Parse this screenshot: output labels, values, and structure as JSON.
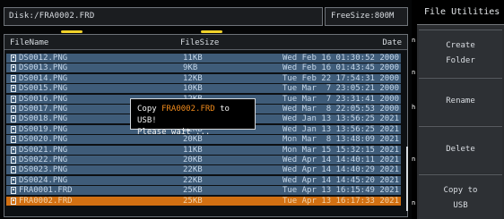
{
  "path_bar": {
    "text": "Disk:/FRA0002.FRD"
  },
  "free_size": {
    "text": "FreeSize:800M"
  },
  "columns": {
    "name": "FileName",
    "size": "FileSize",
    "date": "Date"
  },
  "rows": [
    {
      "name": "DS0012.PNG",
      "size": "11KB",
      "date": "Wed Feb 16 01:30:52 2000"
    },
    {
      "name": "DS0013.PNG",
      "size": "9KB",
      "date": "Wed Feb 16 01:43:45 2000"
    },
    {
      "name": "DS0014.PNG",
      "size": "12KB",
      "date": "Tue Feb 22 17:54:31 2000"
    },
    {
      "name": "DS0015.PNG",
      "size": "10KB",
      "date": "Tue Mar  7 23:05:21 2000"
    },
    {
      "name": "DS0016.PNG",
      "size": "12KB",
      "date": "Tue Mar  7 23:31:41 2000"
    },
    {
      "name": "DS0017.PNG",
      "size": "12KB",
      "date": "Wed Mar  8 22:05:53 2000"
    },
    {
      "name": "DS0018.PNG",
      "size": "22KB",
      "date": "Wed Jan 13 13:56:25 2021"
    },
    {
      "name": "DS0019.PNG",
      "size": "22KB",
      "date": "Wed Jan 13 13:56:25 2021"
    },
    {
      "name": "DS0020.PNG",
      "size": "20KB",
      "date": "Mon Mar  8 13:48:09 2021"
    },
    {
      "name": "DS0021.PNG",
      "size": "11KB",
      "date": "Mon Mar 15 15:32:15 2021"
    },
    {
      "name": "DS0022.PNG",
      "size": "20KB",
      "date": "Wed Apr 14 14:40:11 2021"
    },
    {
      "name": "DS0023.PNG",
      "size": "22KB",
      "date": "Wed Apr 14 14:40:29 2021"
    },
    {
      "name": "DS0024.PNG",
      "size": "22KB",
      "date": "Wed Apr 14 14:45:20 2021"
    },
    {
      "name": "FRA0001.FRD",
      "size": "25KB",
      "date": "Tue Apr 13 16:15:49 2021"
    },
    {
      "name": "FRA0002.FRD",
      "size": "25KB",
      "date": "Tue Apr 13 16:17:33 2021",
      "selected": true
    }
  ],
  "dialog": {
    "prefix": "Copy ",
    "filename": "FRA0002.FRD",
    "suffix": " to USB!",
    "line2": "Please wait ..."
  },
  "sidebar": {
    "title": "File Utilities",
    "buttons": [
      {
        "line1": "Create",
        "line2": "Folder"
      },
      {
        "line1": "Rename",
        "line2": ""
      },
      {
        "line1": "Delete",
        "line2": ""
      },
      {
        "line1": "Copy to",
        "line2": "USB"
      }
    ]
  },
  "colors": {
    "row_bg": "#3f5c79",
    "selected_bg": "#d27012",
    "accent": "#f0d22a",
    "dialog_filename": "#f08a1b"
  }
}
